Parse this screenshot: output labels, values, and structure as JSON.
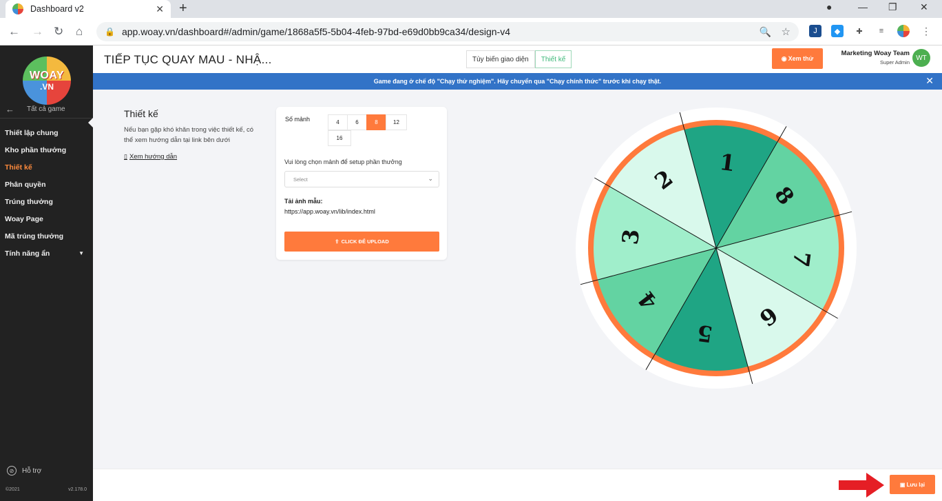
{
  "browser": {
    "tab_title": "Dashboard v2",
    "url": "app.woay.vn/dashboard#/admin/game/1868a5f5-5b04-4feb-97bd-e69d0bb9ca34/design-v4"
  },
  "sidebar": {
    "logo_top": "WOAY",
    "logo_bottom": ".VN",
    "back_label": "Tất cả game",
    "items": [
      {
        "label": "Thiết lập chung"
      },
      {
        "label": "Kho phần thưởng"
      },
      {
        "label": "Thiết kế"
      },
      {
        "label": "Phân quyền"
      },
      {
        "label": "Trúng thưởng"
      },
      {
        "label": "Woay Page"
      },
      {
        "label": "Mã trúng thưởng"
      },
      {
        "label": "Tính năng ẩn"
      }
    ],
    "support_label": "Hỗ trợ",
    "copyright": "©2021",
    "version": "v2.178.0"
  },
  "header": {
    "title": "TIẾP TỤC QUAY MAU - NHẬ...",
    "tab_customize": "Tùy biến giao diện",
    "tab_design": "Thiết kế",
    "preview_label": "Xem thử",
    "user_name": "Marketing Woay Team",
    "user_role": "Super Admin",
    "avatar_initials": "WT"
  },
  "banner": {
    "text": "Game đang ở chế độ \"Chạy thử nghiệm\". Hãy chuyển qua \"Chạy chính thức\" trước khi chạy thật."
  },
  "design": {
    "title": "Thiết kế",
    "description": "Nếu bạn gặp khó khăn trong việc thiết kế, có thể xem hướng dẫn tại link bên dưới",
    "guide_link": "Xem hướng dẫn",
    "pieces_label": "Số mảnh",
    "piece_options": [
      "4",
      "6",
      "8",
      "12",
      "16"
    ],
    "selected_pieces": "8",
    "choose_piece_label": "Vui lòng chọn mảnh để setup phần thưởng",
    "select_placeholder": "Select",
    "sample_label": "Tải ảnh mẫu:",
    "sample_url": "https://app.woay.vn/lib/index.html",
    "upload_label": "CLICK ĐỂ UPLOAD"
  },
  "wheel": {
    "segments": [
      "1",
      "8",
      "7",
      "6",
      "5",
      "4",
      "3",
      "2"
    ],
    "colors": [
      "#1fa584",
      "#63d3a2",
      "#a0eecb",
      "#d9f9ec",
      "#1fa584",
      "#63d3a2",
      "#a0eecb",
      "#d9f9ec"
    ],
    "rim_color": "#ff7a3c"
  },
  "footer": {
    "save_label": "Lưu lại"
  }
}
